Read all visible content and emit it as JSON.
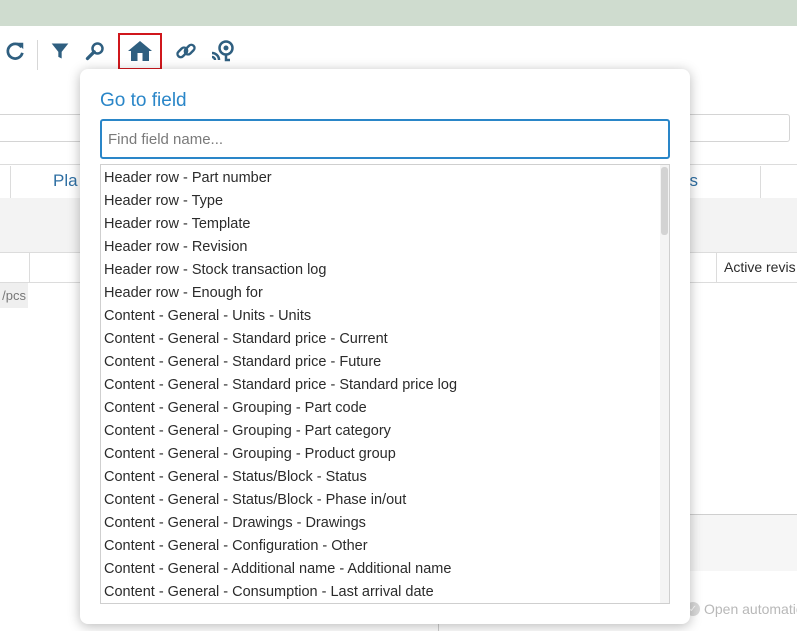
{
  "toolbar": {
    "icons": [
      "refresh-icon",
      "filter-icon",
      "search-icon",
      "home-icon",
      "link-icon",
      "connected-device-icon"
    ],
    "highlight_color": "#d0171c",
    "accent_color": "#2a86c8",
    "icon_color": "#2f5f80"
  },
  "background": {
    "tab_left_partial": "Pla",
    "tab_right_partial": "es",
    "column_header_partial": "Active revis",
    "unit_partial": "/pcs",
    "open_automation_partial": "Open automatio"
  },
  "popup": {
    "title": "Go to field",
    "search_placeholder": "Find field name...",
    "search_value": "",
    "items": [
      "Header row - Part number",
      "Header row - Type",
      "Header row - Template",
      "Header row - Revision",
      "Header row - Stock transaction log",
      "Header row - Enough for",
      "Content - General - Units - Units",
      "Content - General - Standard price - Current",
      "Content - General - Standard price - Future",
      "Content - General - Standard price - Standard price log",
      "Content - General - Grouping - Part code",
      "Content - General - Grouping - Part category",
      "Content - General - Grouping - Product group",
      "Content - General - Status/Block - Status",
      "Content - General - Status/Block - Phase in/out",
      "Content - General - Drawings - Drawings",
      "Content - General - Configuration - Other",
      "Content - General - Additional name - Additional name",
      "Content - General - Consumption - Last arrival date"
    ]
  }
}
